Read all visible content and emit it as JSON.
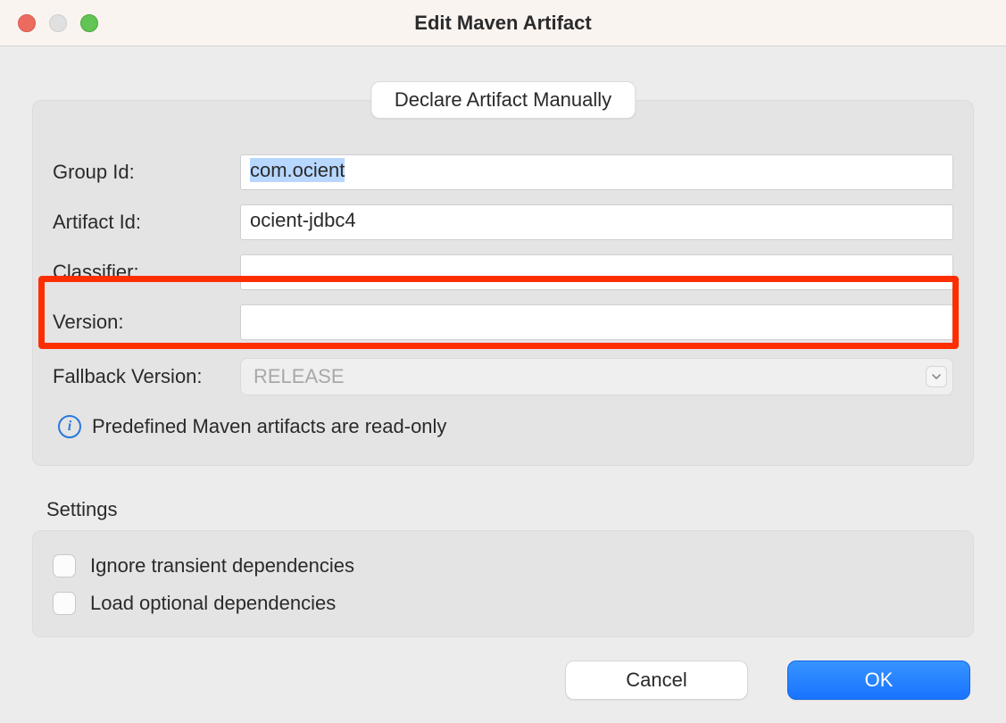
{
  "window": {
    "title": "Edit Maven Artifact"
  },
  "legend": {
    "label": "Declare Artifact Manually"
  },
  "fields": {
    "group_id": {
      "label": "Group Id:",
      "value": "com.ocient"
    },
    "artifact_id": {
      "label": "Artifact Id:",
      "value": "ocient-jdbc4"
    },
    "classifier": {
      "label": "Classifier:",
      "value": ""
    },
    "version": {
      "label": "Version:",
      "value": ""
    },
    "fallback_version": {
      "label": "Fallback Version:",
      "value": "RELEASE"
    }
  },
  "info": {
    "text": "Predefined Maven artifacts are read-only"
  },
  "settings": {
    "header": "Settings",
    "ignore_transient": {
      "label": "Ignore transient dependencies",
      "checked": false
    },
    "load_optional": {
      "label": "Load optional dependencies",
      "checked": false
    }
  },
  "buttons": {
    "cancel": "Cancel",
    "ok": "OK"
  },
  "highlight": {
    "field": "version"
  }
}
